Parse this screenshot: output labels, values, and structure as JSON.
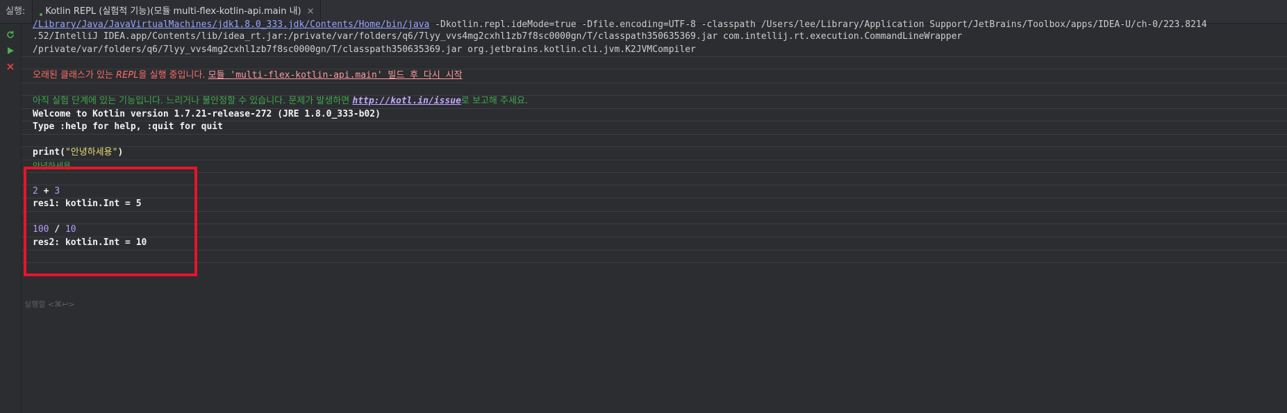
{
  "tabbar": {
    "run_label": "실행:",
    "tab_title": "Kotlin REPL (실험적 기능)(모듈 multi-flex-kotlin-api.main 내)",
    "close_glyph": "×"
  },
  "gutter": {
    "icons": [
      "rerun-icon",
      "run-icon",
      "stop-icon"
    ]
  },
  "console": {
    "cmd_line1_path": "/Library/Java/JavaVirtualMachines/jdk1.8.0_333.jdk/Contents/Home/bin/java",
    "cmd_line1_rest": " -Dkotlin.repl.ideMode=true -Dfile.encoding=UTF-8 -classpath /Users/lee/Library/Application Support/JetBrains/Toolbox/apps/IDEA-U/ch-0/223.8214",
    "cmd_line2": ".52/IntelliJ IDEA.app/Contents/lib/idea_rt.jar:/private/var/folders/q6/7lyy_vvs4mg2cxhl1zb7f8sc0000gn/T/classpath350635369.jar com.intellij.rt.execution.CommandLineWrapper",
    "cmd_line3": "/private/var/folders/q6/7lyy_vvs4mg2cxhl1zb7f8sc0000gn/T/classpath350635369.jar org.jetbrains.kotlin.cli.jvm.K2JVMCompiler",
    "warning_prefix": "오래된 클래스가 있는 ",
    "warning_repl": "REPL",
    "warning_mid": "을 실행 중입니다. ",
    "warning_link": "모듈 'multi-flex-kotlin-api.main' 빌드 후 다시 시작",
    "info_prefix": "아직 실험 단계에 있는 기능입니다. 느리거나 불안정할 수 있습니다. 문제가 발생하면 ",
    "info_link": "http://kotl.in/issue",
    "info_suffix": "로 보고해 주세요.",
    "welcome": "Welcome to Kotlin version 1.7.21-release-272 (JRE 1.8.0_333-b02)",
    "help": "Type :help for help, :quit for quit",
    "cmd1_fn": "print(",
    "cmd1_str": "\"안녕하세용\"",
    "cmd1_close": ")",
    "out1": "안녕하세용",
    "cmd2_a": "2",
    "cmd2_op": " + ",
    "cmd2_b": "3",
    "res1": "res1: kotlin.Int = 5",
    "cmd3_a": "100",
    "cmd3_op": " / ",
    "cmd3_b": "10",
    "res2": "res2: kotlin.Int = 10",
    "prompt": "실행할 <⌘↩>"
  },
  "colors": {
    "background": "#2b2d30",
    "highlight_border": "#e8132b"
  }
}
